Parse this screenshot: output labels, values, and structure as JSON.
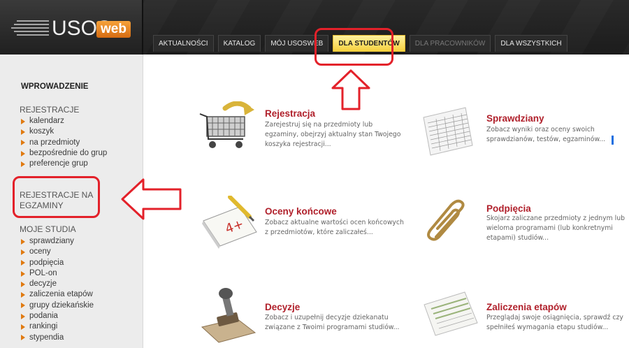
{
  "header": {
    "logo_text": "USOS",
    "logo_badge": "web",
    "tabs": [
      {
        "label": "AKTUALNOŚCI",
        "active": false
      },
      {
        "label": "KATALOG",
        "active": false
      },
      {
        "label": "MÓJ USOSWEB",
        "active": false
      },
      {
        "label": "DLA STUDENTÓW",
        "active": true
      },
      {
        "label": "DLA PRACOWNIKÓW",
        "active": false
      },
      {
        "label": "DLA WSZYSTKICH",
        "active": false
      }
    ]
  },
  "sidebar": {
    "intro": "WPROWADZENIE",
    "sections": [
      {
        "title": "REJESTRACJE",
        "items": [
          "kalendarz",
          "koszyk",
          "na przedmioty",
          "bezpośrednie do grup",
          "preferencje grup"
        ]
      },
      {
        "title_line1": "REJESTRACJE NA",
        "title_line2": "EGZAMINY"
      },
      {
        "title": "MOJE STUDIA",
        "items": [
          "sprawdziany",
          "oceny",
          "podpięcia",
          "POL-on",
          "decyzje",
          "zaliczenia etapów",
          "grupy dziekańskie",
          "podania",
          "rankingi",
          "stypendia"
        ]
      }
    ]
  },
  "cards": [
    {
      "title": "Rejestracja",
      "desc": [
        "Zarejestruj się na przedmioty lub",
        "egzaminy, obejrzyj aktualny stan Twojego",
        "koszyka rejestracji..."
      ],
      "icon": "shopping-cart-icon"
    },
    {
      "title": "Sprawdziany",
      "desc": [
        "Zobacz wyniki oraz oceny swoich",
        "sprawdzianów, testów, egzaminów..."
      ],
      "icon": "score-sheet-icon"
    },
    {
      "title": "Oceny końcowe",
      "desc": [
        "Zobacz aktualne wartości ocen końcowych",
        "z przedmiotów, które zaliczałeś..."
      ],
      "icon": "grade-notebook-icon",
      "grade": "4+"
    },
    {
      "title": "Podpięcia",
      "desc": [
        "Skojarz zaliczane przedmioty z jednym lub",
        "wieloma programami (lub konkretnymi",
        "etapami) studiów..."
      ],
      "icon": "paperclip-icon"
    },
    {
      "title": "Decyzje",
      "desc": [
        "Zobacz i uzupełnij decyzje dziekanatu",
        "związane z Twoimi programami studiów..."
      ],
      "icon": "stamp-icon"
    },
    {
      "title": "Zaliczenia etapów",
      "desc": [
        "Przeglądaj swoje osiągnięcia, sprawdź czy",
        "spełniłeś wymagania etapu studiów..."
      ],
      "icon": "progress-sheet-icon"
    }
  ],
  "colors": {
    "accent": "#b0202b",
    "bullet": "#e07a10",
    "annotation": "#e3212a",
    "active_tab": "#f6cf3a"
  }
}
